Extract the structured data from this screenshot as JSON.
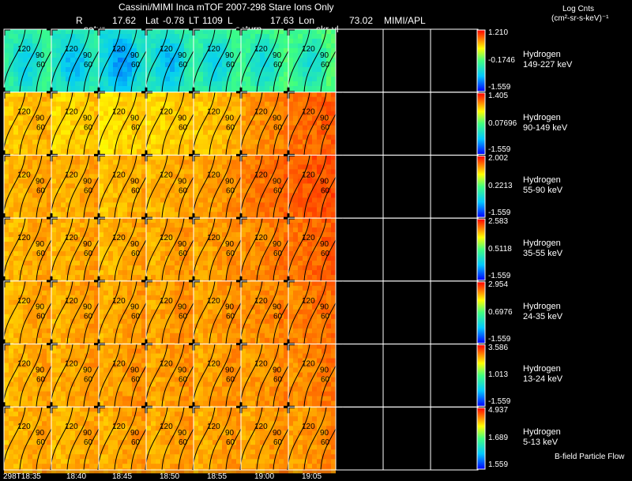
{
  "header": {
    "title": "Cassini/MIMI Inca mTOF  2007-298   Stare   Ions Only",
    "r_label": "R",
    "r_value": "17.62",
    "lat_label": "Lat",
    "lat_value": "-0.78",
    "lt_label": "LT",
    "lt_value": "1109",
    "l_label": "L",
    "l_value": "17.63",
    "lon_label": "Lon",
    "lon_value": "73.02",
    "org": "MIMI/APL",
    "frame_labels": [
      "satur",
      "saturn",
      "skr-vl"
    ],
    "units_line1": "Log Cnts",
    "units_line2": "(cm²-sr-s-keV)⁻¹"
  },
  "footer": {
    "time_ticks": [
      "298T18:35",
      "18:40",
      "18:45",
      "18:50",
      "18:55",
      "19:00",
      "19:05"
    ],
    "legend_note": "B-field Particle Flow"
  },
  "colors": {
    "background": "#000000",
    "text": "#ffffff",
    "panel_border": "#ffffff",
    "contour": "#000000",
    "colormap": [
      "#0000ff",
      "#00ffff",
      "#ffff00",
      "#ff0000"
    ]
  },
  "chart_data": {
    "type": "heatmap",
    "description_axis": "time",
    "time_ticks": [
      "298T18:35",
      "18:40",
      "18:45",
      "18:50",
      "18:55",
      "19:00",
      "19:05"
    ],
    "frames_filled": 7,
    "frames_total": 10,
    "contour_labels": [
      "120",
      "90",
      "60"
    ],
    "bands": [
      {
        "species": "Hydrogen",
        "energy": "149-227 keV",
        "cb_max": "1.210",
        "cb_mid": "-0.1746",
        "cb_min": "-1.559",
        "frame_levels": [
          0.45,
          0.4,
          0.35,
          0.4,
          0.45,
          0.48,
          0.5
        ]
      },
      {
        "species": "Hydrogen",
        "energy": "90-149 keV",
        "cb_max": "1.405",
        "cb_mid": "0.07696",
        "cb_min": "-1.559",
        "frame_levels": [
          0.78,
          0.76,
          0.75,
          0.76,
          0.78,
          0.84,
          0.88
        ]
      },
      {
        "species": "Hydrogen",
        "energy": "55-90 keV",
        "cb_max": "2.002",
        "cb_mid": "0.2213",
        "cb_min": "-1.559",
        "frame_levels": [
          0.8,
          0.8,
          0.79,
          0.8,
          0.82,
          0.87,
          0.9
        ]
      },
      {
        "species": "Hydrogen",
        "energy": "35-55 keV",
        "cb_max": "2.583",
        "cb_mid": "0.5118",
        "cb_min": "-1.559",
        "frame_levels": [
          0.8,
          0.8,
          0.8,
          0.81,
          0.82,
          0.85,
          0.88
        ]
      },
      {
        "species": "Hydrogen",
        "energy": "24-35 keV",
        "cb_max": "2.954",
        "cb_mid": "0.6976",
        "cb_min": "-1.559",
        "frame_levels": [
          0.8,
          0.81,
          0.81,
          0.82,
          0.82,
          0.84,
          0.86
        ]
      },
      {
        "species": "Hydrogen",
        "energy": "13-24 keV",
        "cb_max": "3.586",
        "cb_mid": "1.013",
        "cb_min": "-1.559",
        "frame_levels": [
          0.8,
          0.81,
          0.82,
          0.82,
          0.82,
          0.83,
          0.85
        ]
      },
      {
        "species": "Hydrogen",
        "energy": "5-13 keV",
        "cb_max": "4.937",
        "cb_mid": "1.689",
        "cb_min": "1.559",
        "frame_levels": [
          0.8,
          0.8,
          0.81,
          0.81,
          0.81,
          0.82,
          0.83
        ]
      }
    ]
  }
}
